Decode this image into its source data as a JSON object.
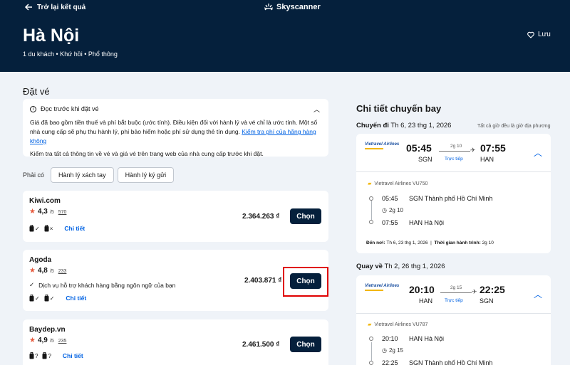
{
  "header": {
    "back_label": "Trở lại kết quả",
    "brand": "Skyscanner",
    "city": "Hà Nội",
    "subtitle": "1 du khách • Khứ hồi • Phổ thông",
    "save_label": "Lưu"
  },
  "booking": {
    "title": "Đặt vé",
    "notice": {
      "heading": "Đọc trước khi đặt vé",
      "body": "Giá đã bao gồm tiền thuế và phí bắt buộc (ước tính). Điều kiện đối với hành lý và vé chỉ là ước tính. Một số nhà cung cấp sẽ phụ thu hành lý, phí bảo hiểm hoặc phí sử dụng thẻ tín dụng.",
      "link": "Kiểm tra phí của hãng hàng không",
      "footer": "Kiểm tra tất cả thông tin về vé và giá vé trên trang web của nhà cung cấp trước khi đặt."
    },
    "bag_filter": {
      "label": "Phải có",
      "options": [
        "Hành lý xách tay",
        "Hành lý ký gửi"
      ]
    },
    "details_label": "Chi tiết",
    "choose_label": "Chọn",
    "rating_max": "/5",
    "offers": [
      {
        "agent": "Kiwi.com",
        "rating": "4,3",
        "reviews": "570",
        "price": "2.364.263 ₫",
        "cabin": "✓",
        "checked": "×"
      },
      {
        "agent": "Agoda",
        "rating": "4,8",
        "reviews": "233",
        "price": "2.403.871 ₫",
        "feature": "Dịch vụ hỗ trợ khách hàng bằng ngôn ngữ của bạn",
        "cabin": "✓",
        "checked": "✓"
      },
      {
        "agent": "Baydep.vn",
        "rating": "4,9",
        "reviews": "235",
        "price": "2.461.500 ₫",
        "cabin": "?",
        "checked": "?"
      }
    ]
  },
  "flight_details": {
    "title": "Chi tiết chuyến bay",
    "timezone_note": "Tất cả giờ đều là giờ địa phương",
    "outbound": {
      "label": "Chuyến đi",
      "date": "Th 6, 23 thg 1, 2026",
      "airline_logo": "Vietravel Airlines",
      "dep_time": "05:45",
      "dep_code": "SGN",
      "arr_time": "07:55",
      "arr_code": "HAN",
      "duration": "2g 10",
      "stops": "Trực tiếp",
      "flight_no": "Vietravel Airlines VU750",
      "dep_place": "SGN Thành phố Hồ Chí Minh",
      "arr_place": "HAN Hà Nội",
      "arrival_label": "Đến nơi:",
      "arrival_date": "Th 6, 23 thg 1, 2026",
      "journey_label": "Thời gian hành trình:",
      "journey_time": "2g 10"
    },
    "return": {
      "label": "Quay về",
      "date": "Th 2, 26 thg 1, 2026",
      "airline_logo": "Vietravel Airlines",
      "dep_time": "20:10",
      "dep_code": "HAN",
      "arr_time": "22:25",
      "arr_code": "SGN",
      "duration": "2g 15",
      "stops": "Trực tiếp",
      "flight_no": "Vietravel Airlines VU787",
      "dep_place": "HAN Hà Nội",
      "arr_place": "SGN Thành phố Hồ Chí Minh"
    }
  },
  "colors": {
    "header_bg": "#05203c",
    "accent": "#0062e3",
    "star": "#e7593c",
    "highlight": "#e00000"
  }
}
